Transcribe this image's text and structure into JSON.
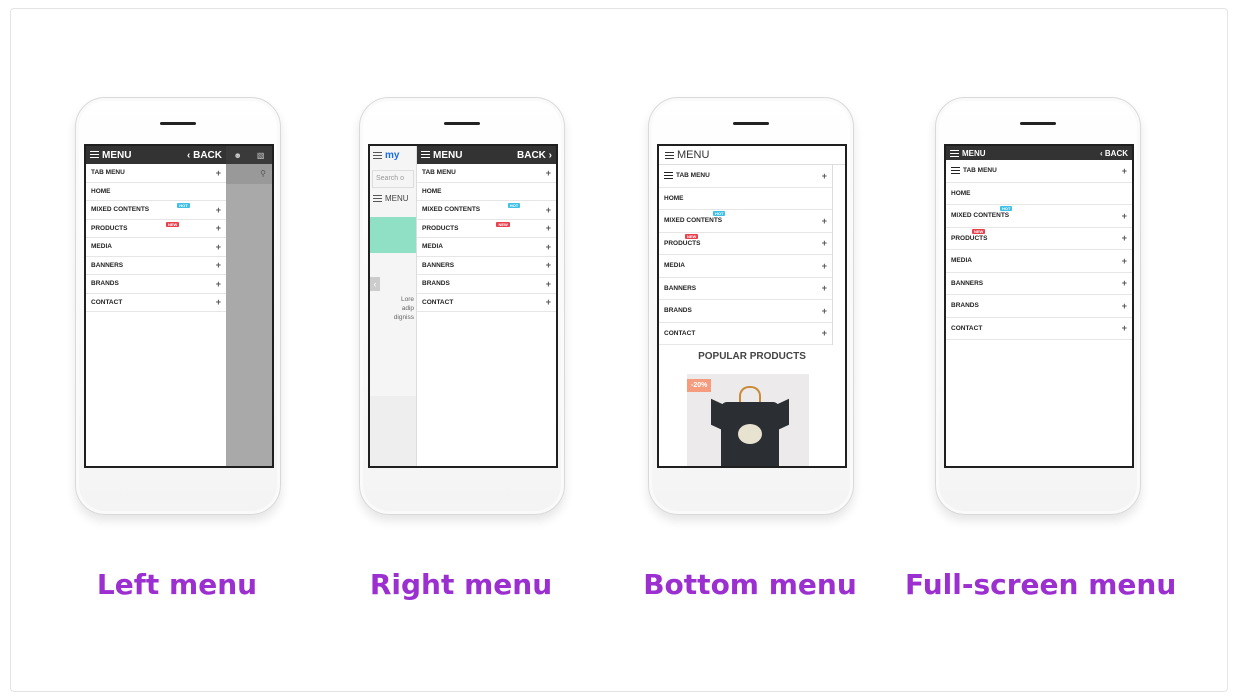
{
  "phones": {
    "left": {
      "header_title": "MENU",
      "back_label": "‹ BACK",
      "items": [
        {
          "label": "TAB MENU",
          "plus": "+",
          "badge": ""
        },
        {
          "label": "HOME",
          "plus": "",
          "badge": ""
        },
        {
          "label": "MIXED CONTENTS",
          "plus": "+",
          "badge": "HOT"
        },
        {
          "label": "PRODUCTS",
          "plus": "+",
          "badge": "NEW"
        },
        {
          "label": "MEDIA",
          "plus": "+",
          "badge": ""
        },
        {
          "label": "BANNERS",
          "plus": "+",
          "badge": ""
        },
        {
          "label": "BRANDS",
          "plus": "+",
          "badge": ""
        },
        {
          "label": "CONTACT",
          "plus": "+",
          "badge": ""
        }
      ]
    },
    "right": {
      "header_title": "MENU",
      "back_label": "BACK ›",
      "logo": "my",
      "search_placeholder": "Search o",
      "bg_menu": "MENU",
      "bg_text1": "Lore",
      "bg_text2": "adip",
      "bg_text3": "digniss",
      "items": [
        {
          "label": "TAB MENU",
          "plus": "+",
          "badge": ""
        },
        {
          "label": "HOME",
          "plus": "",
          "badge": ""
        },
        {
          "label": "MIXED CONTENTS",
          "plus": "+",
          "badge": "HOT"
        },
        {
          "label": "PRODUCTS",
          "plus": "+",
          "badge": "NEW"
        },
        {
          "label": "MEDIA",
          "plus": "+",
          "badge": ""
        },
        {
          "label": "BANNERS",
          "plus": "+",
          "badge": ""
        },
        {
          "label": "BRANDS",
          "plus": "+",
          "badge": ""
        },
        {
          "label": "CONTACT",
          "plus": "+",
          "badge": ""
        }
      ]
    },
    "bottom": {
      "header_title": "MENU",
      "items": [
        {
          "label": "TAB MENU",
          "plus": "+",
          "badge": ""
        },
        {
          "label": "HOME",
          "plus": "",
          "badge": ""
        },
        {
          "label": "MIXED CONTENTS",
          "plus": "+",
          "badge": "HOT"
        },
        {
          "label": "PRODUCTS",
          "plus": "+",
          "badge": "NEW"
        },
        {
          "label": "MEDIA",
          "plus": "+",
          "badge": ""
        },
        {
          "label": "BANNERS",
          "plus": "+",
          "badge": ""
        },
        {
          "label": "BRANDS",
          "plus": "+",
          "badge": ""
        },
        {
          "label": "CONTACT",
          "plus": "+",
          "badge": ""
        }
      ],
      "section_title": "POPULAR PRODUCTS",
      "discount": "-20%"
    },
    "full": {
      "header_title": "MENU",
      "back_label": "‹ BACK",
      "items": [
        {
          "label": "TAB MENU",
          "plus": "+",
          "badge": ""
        },
        {
          "label": "HOME",
          "plus": "",
          "badge": ""
        },
        {
          "label": "MIXED CONTENTS",
          "plus": "+",
          "badge": "HOT"
        },
        {
          "label": "PRODUCTS",
          "plus": "+",
          "badge": "NEW"
        },
        {
          "label": "MEDIA",
          "plus": "+",
          "badge": ""
        },
        {
          "label": "BANNERS",
          "plus": "+",
          "badge": ""
        },
        {
          "label": "BRANDS",
          "plus": "+",
          "badge": ""
        },
        {
          "label": "CONTACT",
          "plus": "+",
          "badge": ""
        }
      ]
    }
  },
  "captions": {
    "left": "Left menu",
    "right": "Right menu",
    "bottom": "Bottom menu",
    "full": "Full-screen menu"
  },
  "colors": {
    "caption": "#9b2fd0",
    "header_bg": "#333333",
    "badge_hot": "#3fc0e6",
    "badge_new": "#e8414d",
    "discount": "#f59c7e"
  }
}
